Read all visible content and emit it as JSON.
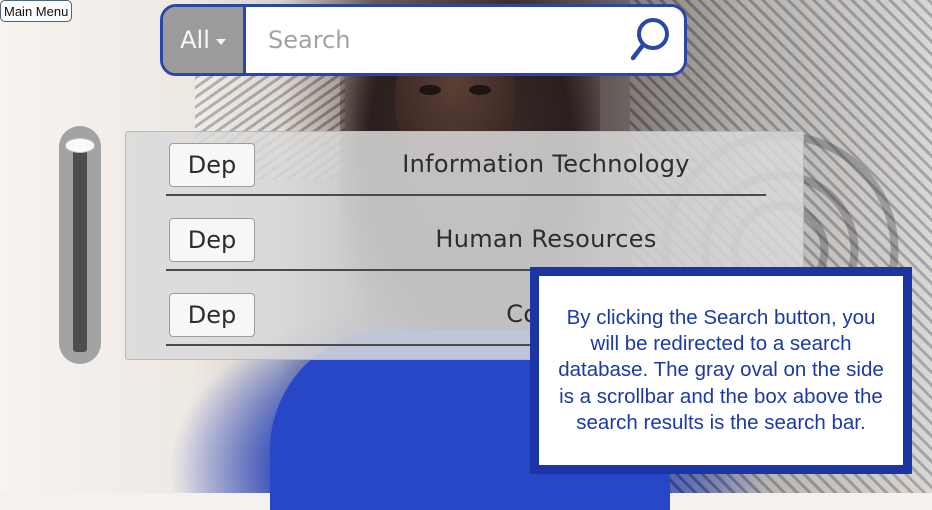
{
  "main_menu": {
    "label": "Main Menu"
  },
  "search": {
    "scope": "All",
    "placeholder": "Search",
    "button_icon": "search-icon"
  },
  "results": [
    {
      "badge": "Dep",
      "name": "Information Technology"
    },
    {
      "badge": "Dep",
      "name": "Human Resources"
    },
    {
      "badge": "Dep",
      "name": "Comm"
    }
  ],
  "annotation": {
    "text": "By clicking the Search button, you will be redirected to a search database. The gray oval on the side is a scrollbar and the box above the search results is the search bar."
  },
  "colors": {
    "accent_blue": "#2a47a7",
    "callout_border": "#1c35a4",
    "callout_text": "#1b3aa3",
    "scope_gray": "#9b9b9b"
  }
}
